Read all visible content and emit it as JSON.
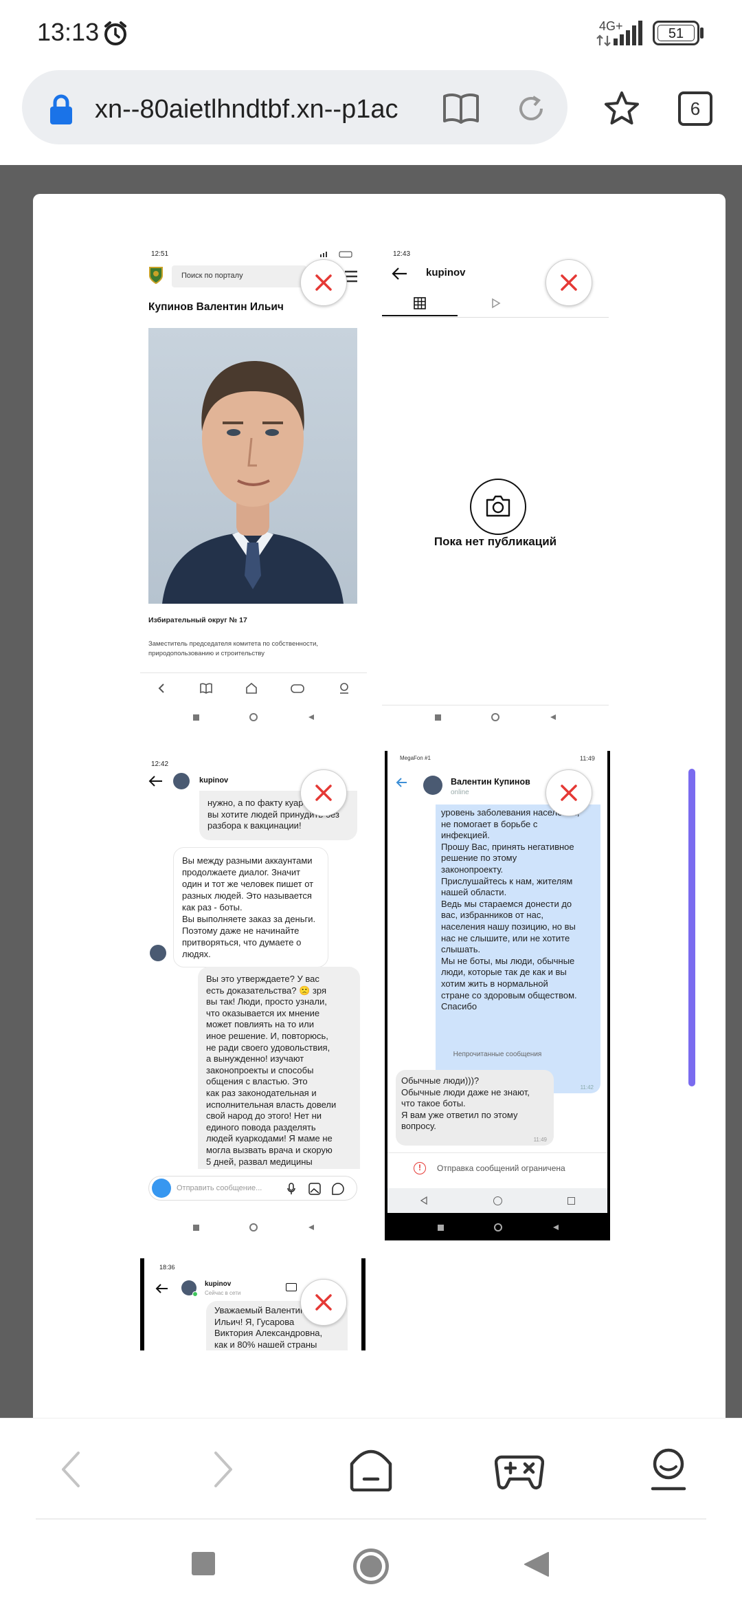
{
  "status_bar": {
    "time": "13:13",
    "network": "4G+",
    "battery": "51"
  },
  "browser": {
    "url": "xn--80aietlhndtbf.xn--p1ac",
    "tab_count": "6"
  },
  "thumbnails": {
    "t1": {
      "time": "12:51",
      "search_placeholder": "Поиск по порталу",
      "name": "Купинов Валентин Ильич",
      "district": "Избирательный округ № 17",
      "position": "Заместитель председателя комитета по собственности, природопользованию и строительству"
    },
    "t2": {
      "time": "12:43",
      "username": "kupinov",
      "empty_text": "Пока нет публикаций"
    },
    "t3": {
      "time": "12:42",
      "username": "kupinov",
      "msg1": "нужно, а по факту куар\nвы хотите людей принудить без\nразбора к вакцинации!",
      "msg2": "Вы между разными аккаунтами\nпродолжаете диалог. Значит\nодин и тот же человек пишет от\nразных людей. Это называется\nкак раз - боты.\nВы выполняете заказ за деньги.\nПоэтому даже не начинайте\nпритворяться, что думаете о\nлюдях.",
      "msg3": "Вы это утверждаете? У вас\nесть доказательства? 🙁 зря\nвы так! Люди, просто узнали,\nчто оказывается их мнение\nможет повлиять на то или\nиное решение. И, повторюсь,\nне ради своего удовольствия,\nа вынужденно! изучают\nзаконопроекты и способы\nобщения с властью. Это\nкак раз законодательная и\nисполнительная власть довели\nсвой народ до этого! Нет ни\nединого повода разделять\nлюдей куаркодами! Я маме не\nмогла вызвать врача и скорую\n5 дней, развал медицины",
      "input_placeholder": "Отправить сообщение..."
    },
    "t4": {
      "carrier": "MegaFon #1",
      "time": "11:49",
      "contact": "Валентин Купинов",
      "online": "online",
      "msg_out": "уровень заболевания населения,\nне помогает в борьбе с\nинфекцией.\nПрошу Вас, принять негативное\nрешение по этому\nзаконопроекту.\nПрислушайтесь к нам, жителям\nнашей области.\nВедь мы стараемся донести до\nвас, избранников от нас,\nнаселения нашу позицию, но вы\nнас не слышите, или не хотите\nслышать.\nМы не боты, мы люди, обычные\nлюди, которые так де как и вы\nхотим жить в нормальной\nстране со здоровым обществом.\nСпасибо",
      "msg_out_time": "11:42",
      "unread_label": "Непрочитанные сообщения",
      "msg_in": "Обычные люди)))?\nОбычные люди даже не знают,\nчто такое боты.\nЯ вам уже ответил по этому\nвопросу.",
      "msg_in_time": "11:49",
      "restricted": "Отправка сообщений ограничена"
    },
    "t5": {
      "time": "18:36",
      "username": "kupinov",
      "status": "Сейчас в сети",
      "msg": "Уважаемый Валентин\nИльич! Я, Гусарова\nВиктория Александровна,\nкак и 80% нашей страны"
    }
  },
  "colors": {
    "accent": "#1a73e8",
    "close": "#e53935",
    "scroll": "#7a6bef",
    "tg_bubble": "#cfe3fb"
  }
}
